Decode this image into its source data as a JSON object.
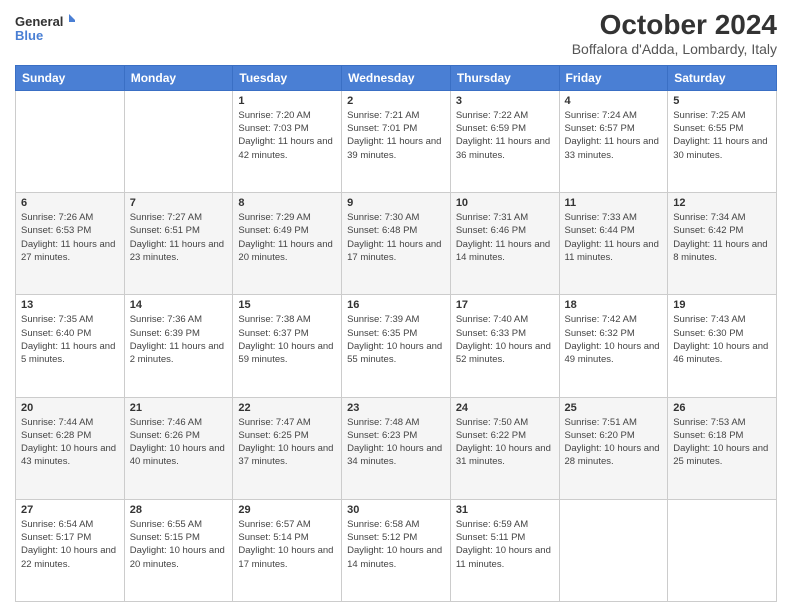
{
  "logo": {
    "line1": "General",
    "line2": "Blue"
  },
  "header": {
    "month": "October 2024",
    "location": "Boffalora d'Adda, Lombardy, Italy"
  },
  "weekdays": [
    "Sunday",
    "Monday",
    "Tuesday",
    "Wednesday",
    "Thursday",
    "Friday",
    "Saturday"
  ],
  "weeks": [
    [
      {
        "day": "",
        "info": ""
      },
      {
        "day": "",
        "info": ""
      },
      {
        "day": "1",
        "info": "Sunrise: 7:20 AM\nSunset: 7:03 PM\nDaylight: 11 hours and 42 minutes."
      },
      {
        "day": "2",
        "info": "Sunrise: 7:21 AM\nSunset: 7:01 PM\nDaylight: 11 hours and 39 minutes."
      },
      {
        "day": "3",
        "info": "Sunrise: 7:22 AM\nSunset: 6:59 PM\nDaylight: 11 hours and 36 minutes."
      },
      {
        "day": "4",
        "info": "Sunrise: 7:24 AM\nSunset: 6:57 PM\nDaylight: 11 hours and 33 minutes."
      },
      {
        "day": "5",
        "info": "Sunrise: 7:25 AM\nSunset: 6:55 PM\nDaylight: 11 hours and 30 minutes."
      }
    ],
    [
      {
        "day": "6",
        "info": "Sunrise: 7:26 AM\nSunset: 6:53 PM\nDaylight: 11 hours and 27 minutes."
      },
      {
        "day": "7",
        "info": "Sunrise: 7:27 AM\nSunset: 6:51 PM\nDaylight: 11 hours and 23 minutes."
      },
      {
        "day": "8",
        "info": "Sunrise: 7:29 AM\nSunset: 6:49 PM\nDaylight: 11 hours and 20 minutes."
      },
      {
        "day": "9",
        "info": "Sunrise: 7:30 AM\nSunset: 6:48 PM\nDaylight: 11 hours and 17 minutes."
      },
      {
        "day": "10",
        "info": "Sunrise: 7:31 AM\nSunset: 6:46 PM\nDaylight: 11 hours and 14 minutes."
      },
      {
        "day": "11",
        "info": "Sunrise: 7:33 AM\nSunset: 6:44 PM\nDaylight: 11 hours and 11 minutes."
      },
      {
        "day": "12",
        "info": "Sunrise: 7:34 AM\nSunset: 6:42 PM\nDaylight: 11 hours and 8 minutes."
      }
    ],
    [
      {
        "day": "13",
        "info": "Sunrise: 7:35 AM\nSunset: 6:40 PM\nDaylight: 11 hours and 5 minutes."
      },
      {
        "day": "14",
        "info": "Sunrise: 7:36 AM\nSunset: 6:39 PM\nDaylight: 11 hours and 2 minutes."
      },
      {
        "day": "15",
        "info": "Sunrise: 7:38 AM\nSunset: 6:37 PM\nDaylight: 10 hours and 59 minutes."
      },
      {
        "day": "16",
        "info": "Sunrise: 7:39 AM\nSunset: 6:35 PM\nDaylight: 10 hours and 55 minutes."
      },
      {
        "day": "17",
        "info": "Sunrise: 7:40 AM\nSunset: 6:33 PM\nDaylight: 10 hours and 52 minutes."
      },
      {
        "day": "18",
        "info": "Sunrise: 7:42 AM\nSunset: 6:32 PM\nDaylight: 10 hours and 49 minutes."
      },
      {
        "day": "19",
        "info": "Sunrise: 7:43 AM\nSunset: 6:30 PM\nDaylight: 10 hours and 46 minutes."
      }
    ],
    [
      {
        "day": "20",
        "info": "Sunrise: 7:44 AM\nSunset: 6:28 PM\nDaylight: 10 hours and 43 minutes."
      },
      {
        "day": "21",
        "info": "Sunrise: 7:46 AM\nSunset: 6:26 PM\nDaylight: 10 hours and 40 minutes."
      },
      {
        "day": "22",
        "info": "Sunrise: 7:47 AM\nSunset: 6:25 PM\nDaylight: 10 hours and 37 minutes."
      },
      {
        "day": "23",
        "info": "Sunrise: 7:48 AM\nSunset: 6:23 PM\nDaylight: 10 hours and 34 minutes."
      },
      {
        "day": "24",
        "info": "Sunrise: 7:50 AM\nSunset: 6:22 PM\nDaylight: 10 hours and 31 minutes."
      },
      {
        "day": "25",
        "info": "Sunrise: 7:51 AM\nSunset: 6:20 PM\nDaylight: 10 hours and 28 minutes."
      },
      {
        "day": "26",
        "info": "Sunrise: 7:53 AM\nSunset: 6:18 PM\nDaylight: 10 hours and 25 minutes."
      }
    ],
    [
      {
        "day": "27",
        "info": "Sunrise: 6:54 AM\nSunset: 5:17 PM\nDaylight: 10 hours and 22 minutes."
      },
      {
        "day": "28",
        "info": "Sunrise: 6:55 AM\nSunset: 5:15 PM\nDaylight: 10 hours and 20 minutes."
      },
      {
        "day": "29",
        "info": "Sunrise: 6:57 AM\nSunset: 5:14 PM\nDaylight: 10 hours and 17 minutes."
      },
      {
        "day": "30",
        "info": "Sunrise: 6:58 AM\nSunset: 5:12 PM\nDaylight: 10 hours and 14 minutes."
      },
      {
        "day": "31",
        "info": "Sunrise: 6:59 AM\nSunset: 5:11 PM\nDaylight: 10 hours and 11 minutes."
      },
      {
        "day": "",
        "info": ""
      },
      {
        "day": "",
        "info": ""
      }
    ]
  ]
}
